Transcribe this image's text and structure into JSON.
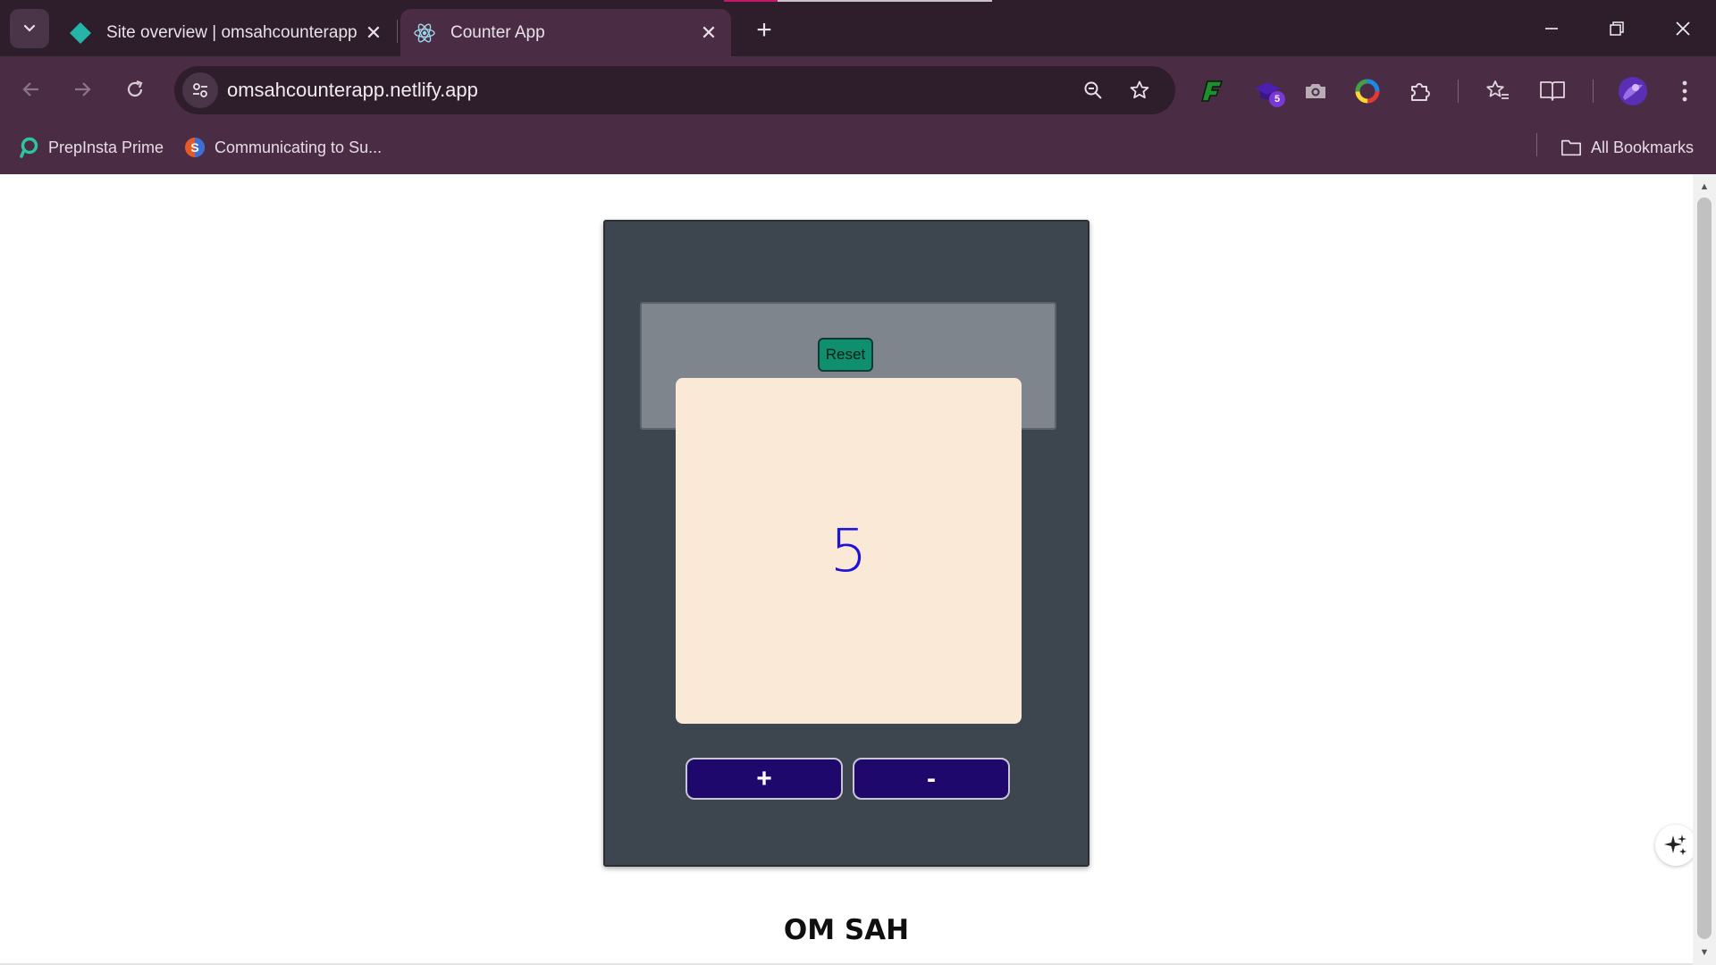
{
  "browser": {
    "tabs": [
      {
        "title": "Site overview | omsahcounterapp |",
        "active": false
      },
      {
        "title": "Counter App",
        "active": true
      }
    ],
    "url": "omsahcounterapp.netlify.app",
    "extension_badge": "5",
    "bookmarks": [
      {
        "label": "PrepInsta Prime"
      },
      {
        "label": "Communicating to Su..."
      }
    ],
    "all_bookmarks_label": "All Bookmarks"
  },
  "app": {
    "reset_label": "Reset",
    "count": "5",
    "increment_label": "+",
    "decrement_label": "-",
    "author": "OM SAH"
  },
  "colors": {
    "card_bg": "#3d464e",
    "panel_bg": "#7f858d",
    "reset_bg": "#0f8f6d",
    "display_bg": "#fae9d6",
    "count_color": "#1f12d9",
    "button_bg": "#1f086c",
    "chrome_bg": "#4a2d45"
  },
  "icons": {
    "tab_search": "chevron-down-icon",
    "tab1_favicon": "netlify-icon",
    "tab2_favicon": "react-icon",
    "back": "arrow-left-icon",
    "forward": "arrow-right-icon",
    "reload": "reload-icon",
    "site_info": "tune-icon",
    "zoom": "zoom-icon",
    "star": "star-icon"
  }
}
